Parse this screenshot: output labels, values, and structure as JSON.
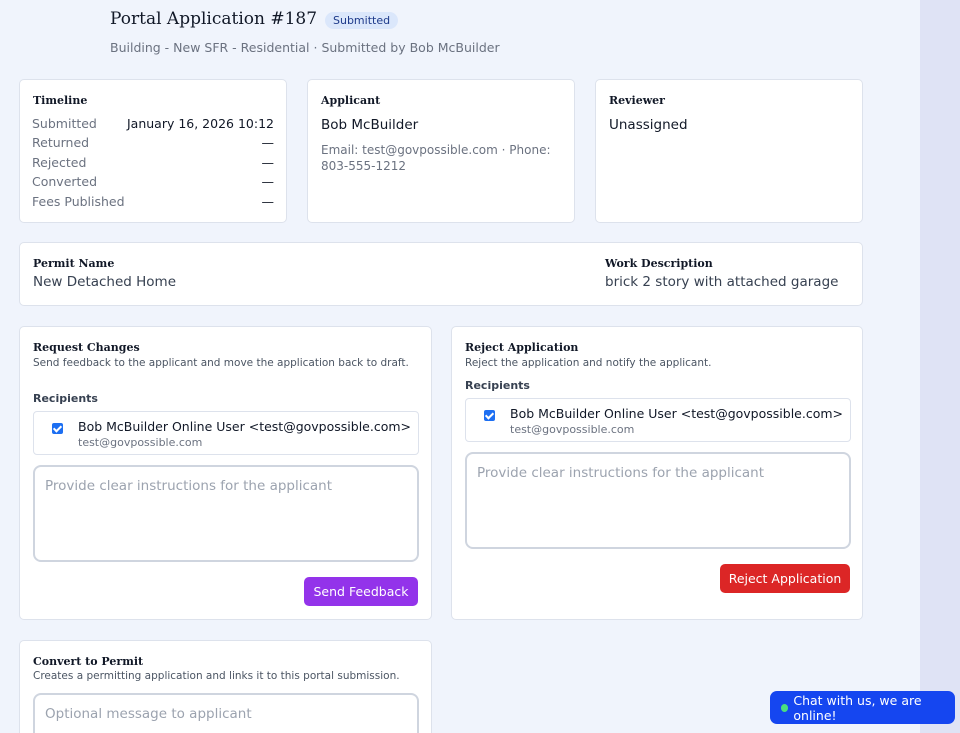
{
  "header": {
    "title": "Portal Application #187",
    "status_badge": "Submitted",
    "subtitle": "Building - New SFR - Residential · Submitted by Bob McBuilder"
  },
  "timeline": {
    "heading": "Timeline",
    "rows": [
      {
        "label": "Submitted",
        "value": "January 16, 2026 10:12"
      },
      {
        "label": "Returned",
        "value": "—"
      },
      {
        "label": "Rejected",
        "value": "—"
      },
      {
        "label": "Converted",
        "value": "—"
      },
      {
        "label": "Fees Published",
        "value": "—"
      }
    ]
  },
  "applicant": {
    "heading": "Applicant",
    "name": "Bob McBuilder",
    "contact": "Email: test@govpossible.com · Phone: 803-555-1212"
  },
  "reviewer": {
    "heading": "Reviewer",
    "value": "Unassigned"
  },
  "permit": {
    "name_heading": "Permit Name",
    "name_value": "New Detached Home",
    "work_heading": "Work Description",
    "work_value": "brick 2 story with attached garage"
  },
  "request_changes": {
    "heading": "Request Changes",
    "description": "Send feedback to the applicant and move the application back to draft.",
    "recipients_label": "Recipients",
    "recipient_name": "Bob McBuilder Online User <test@govpossible.com>",
    "recipient_email": "test@govpossible.com",
    "placeholder": "Provide clear instructions for the applicant",
    "button_label": "Send Feedback"
  },
  "reject_application": {
    "heading": "Reject Application",
    "description": "Reject the application and notify the applicant.",
    "recipients_label": "Recipients",
    "recipient_name": "Bob McBuilder Online User <test@govpossible.com>",
    "recipient_email": "test@govpossible.com",
    "placeholder": "Provide clear instructions for the applicant",
    "button_label": "Reject Application"
  },
  "convert": {
    "heading": "Convert to Permit",
    "description": "Creates a permitting application and links it to this portal submission.",
    "placeholder": "Optional message to applicant"
  },
  "chat": {
    "label": "Chat with us, we are online!"
  },
  "colors": {
    "primary_button": "#9333ea",
    "danger_button": "#dc2626",
    "chat_button": "#1546f0",
    "badge_bg": "#dbe7fb"
  }
}
